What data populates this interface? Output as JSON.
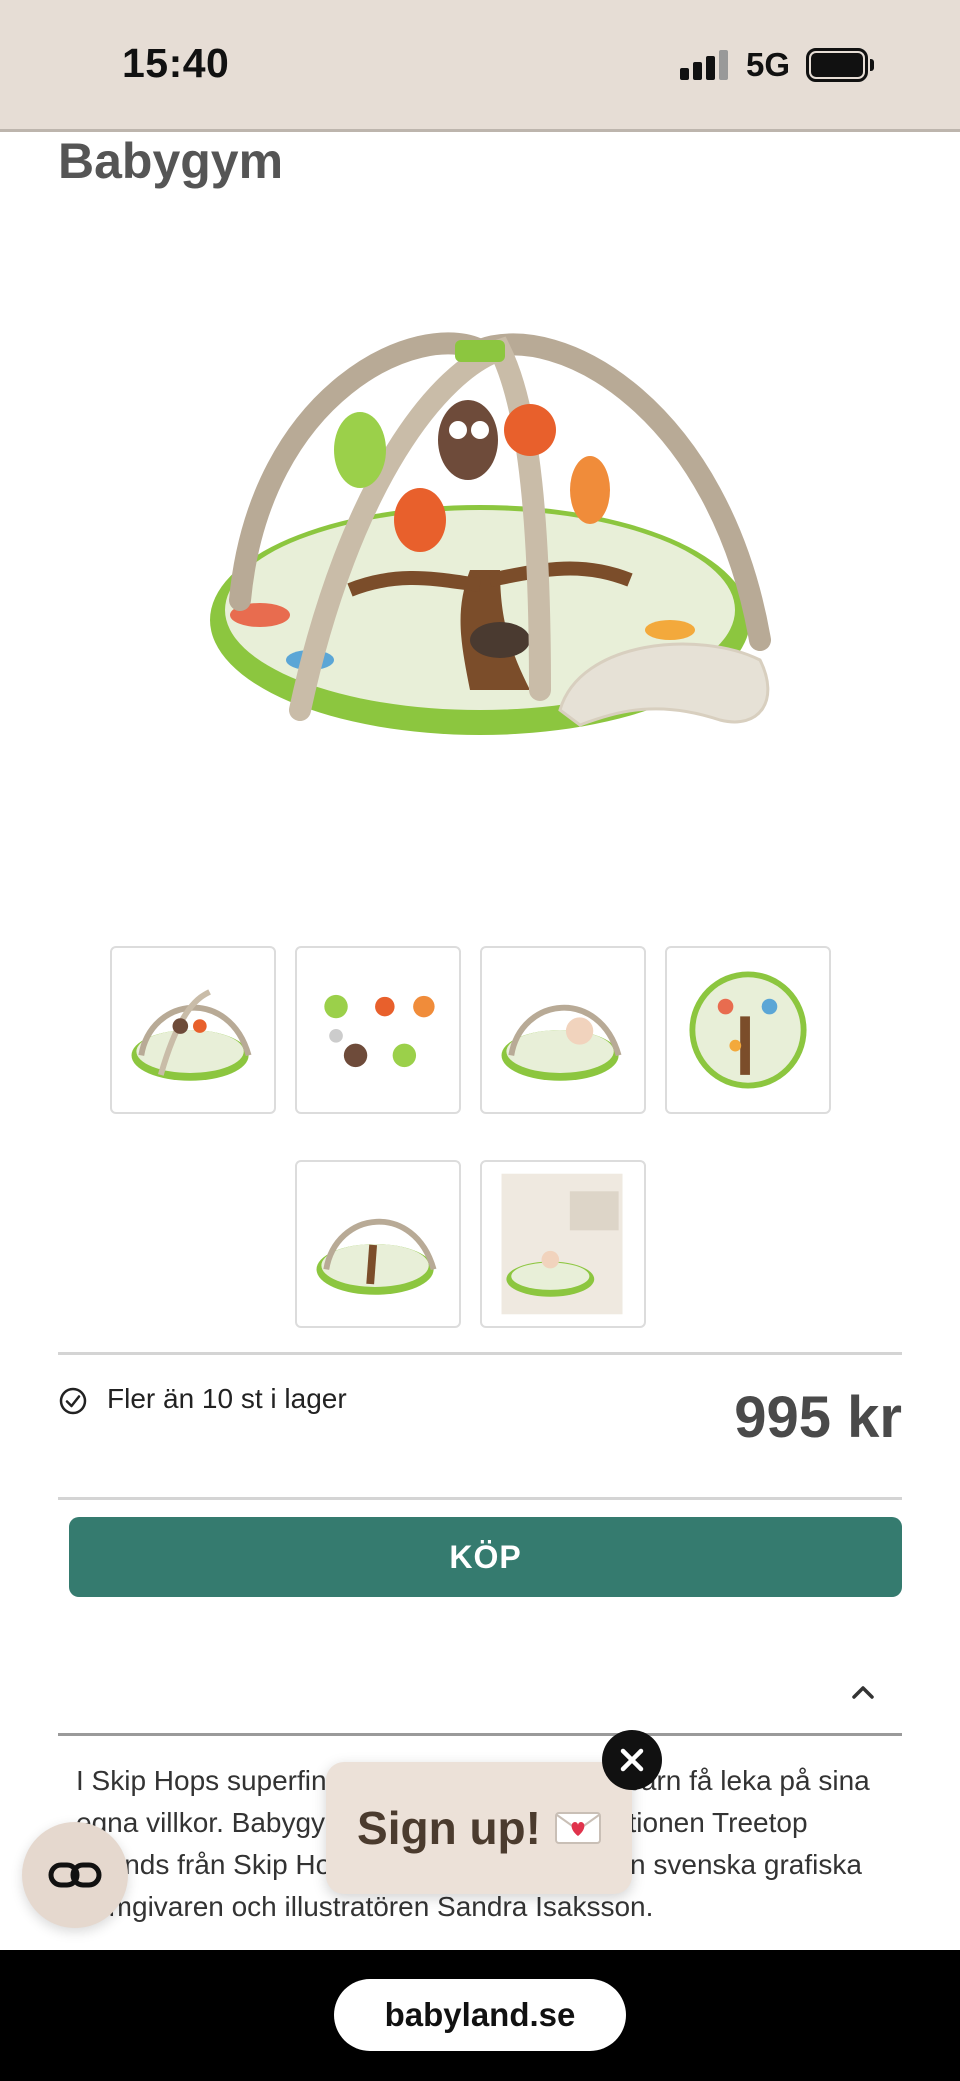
{
  "status_bar": {
    "time": "15:40",
    "network": "5G"
  },
  "product": {
    "title": "Babygym",
    "stock_text": "Fler än 10 st i lager",
    "price": "995 kr",
    "buy_label": "KÖP",
    "description": "I Skip Hops superfina babygym kommer ditt barn få leka på sina egna villkor. Babygymmet är en del av kollektionen Treetop Friends från Skip Hop och är illustrerat av den svenska grafiska formgivaren och illustratören Sandra Isaksson."
  },
  "signup": {
    "label": "Sign up!"
  },
  "browser": {
    "url": "babyland.se"
  },
  "colors": {
    "accent": "#357b6f",
    "status_bg": "#e6ddd5",
    "popup_bg": "#ece1d8"
  }
}
